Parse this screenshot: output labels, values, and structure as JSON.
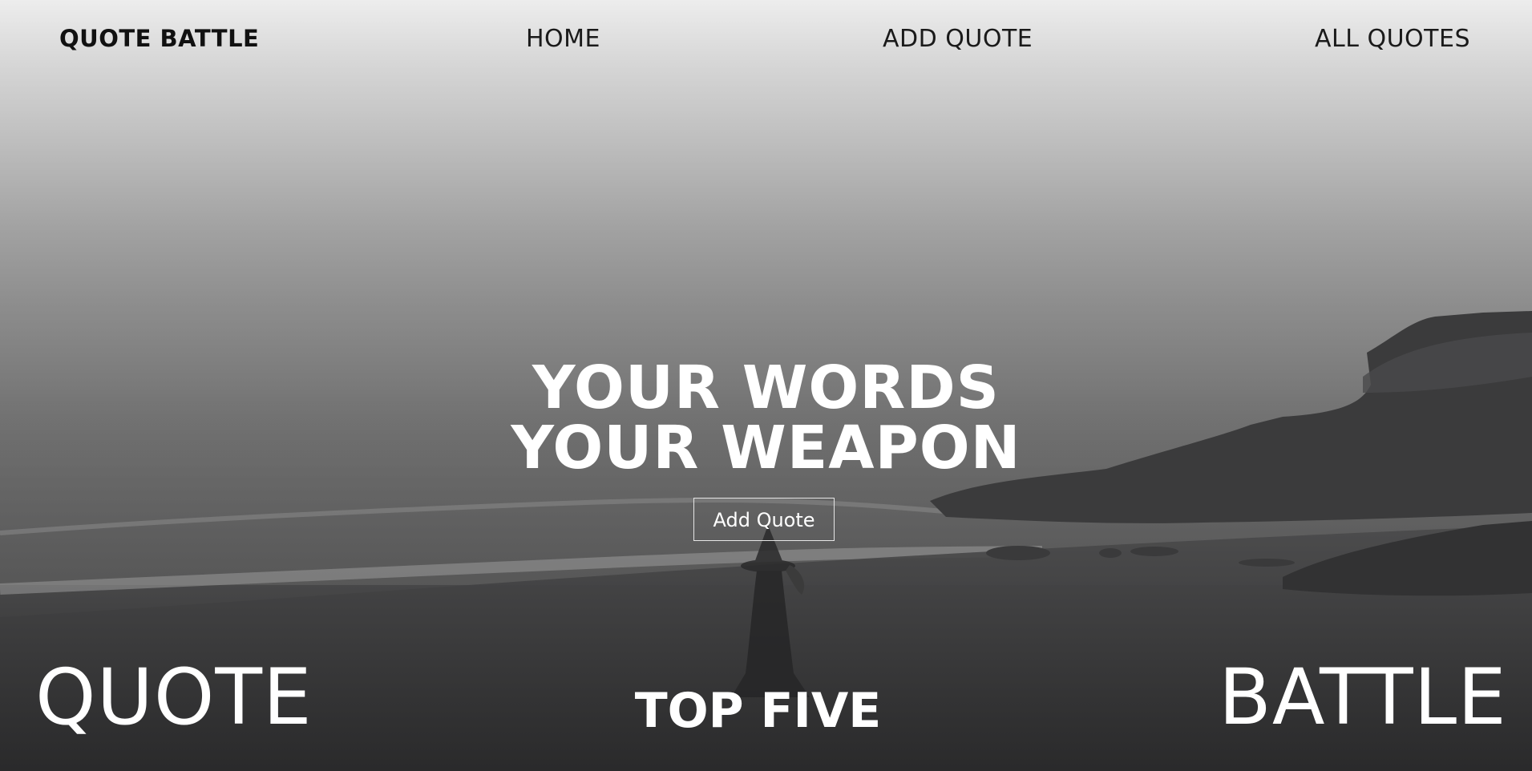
{
  "nav": {
    "brand": "QUOTE BATTLE",
    "home": "HOME",
    "add_quote": "ADD QUOTE",
    "all_quotes": "ALL QUOTES"
  },
  "hero": {
    "line1": "YOUR WORDS",
    "line2": "YOUR WEAPON",
    "button_label": "Add Quote"
  },
  "bottom": {
    "left_word": "QUOTE",
    "center_word": "TOP FIVE",
    "right_word": "BATTLE"
  },
  "colors": {
    "text_light": "#ffffff",
    "text_dark": "#1a1a1a",
    "sky_top": "#ededed",
    "ground": "#2d2d2e"
  }
}
